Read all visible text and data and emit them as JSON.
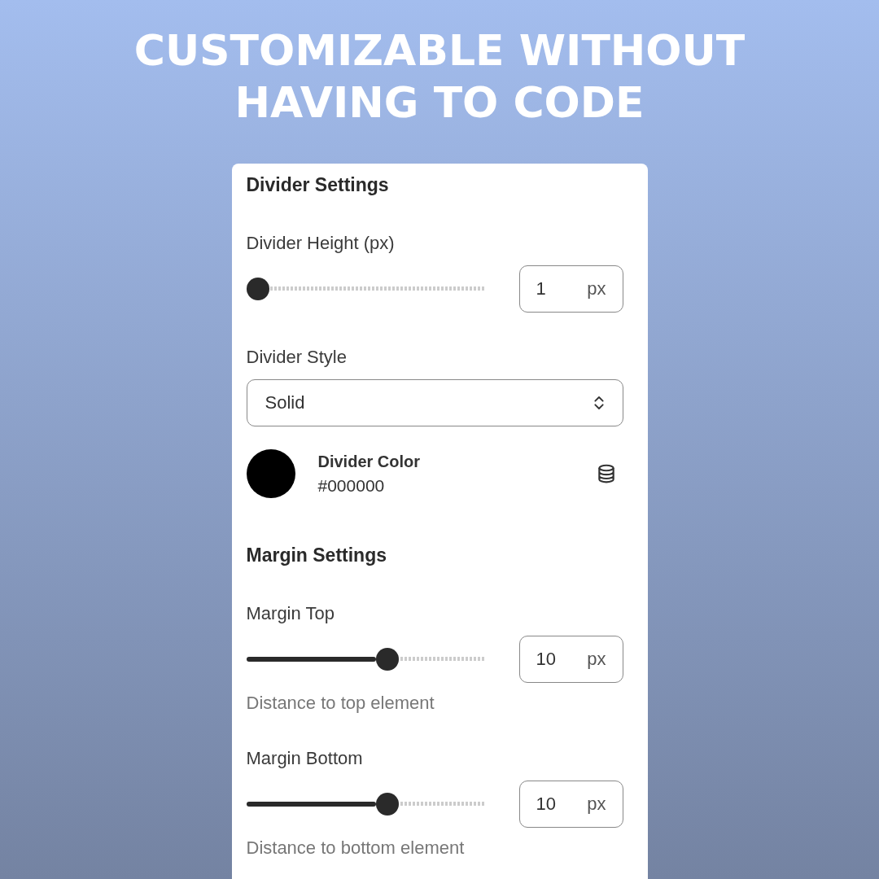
{
  "headline": [
    "CUSTOMIZABLE WITHOUT",
    "HAVING TO CODE"
  ],
  "panel": [
    {
      "kind": "heading",
      "label": "Divider Settings"
    },
    {
      "kind": "slider",
      "label": "Divider Height (px)",
      "level": 0,
      "value": "1",
      "unit": "px"
    },
    {
      "kind": "select",
      "label": "Divider Style",
      "value": "Solid"
    },
    {
      "kind": "color",
      "label": "Divider Color",
      "value": "#000000",
      "color": "#000000"
    },
    {
      "kind": "heading",
      "label": "Margin Settings"
    },
    {
      "kind": "slider",
      "label": "Margin Top",
      "level": 0.57,
      "value": "10",
      "unit": "px",
      "hint": "Distance to top element"
    },
    {
      "kind": "slider",
      "label": "Margin Bottom",
      "level": 0.57,
      "value": "10",
      "unit": "px",
      "hint": "Distance to bottom element"
    }
  ]
}
